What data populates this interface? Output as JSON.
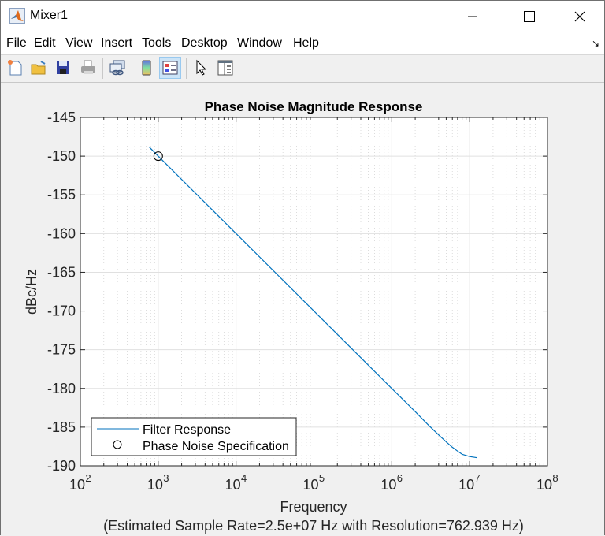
{
  "window": {
    "title": "Mixer1",
    "controls": [
      "minimize",
      "maximize",
      "close"
    ]
  },
  "menu": [
    "File",
    "Edit",
    "View",
    "Insert",
    "Tools",
    "Desktop",
    "Window",
    "Help"
  ],
  "toolbar": [
    {
      "icon": "new-figure-icon"
    },
    {
      "icon": "open-file-icon"
    },
    {
      "icon": "save-icon"
    },
    {
      "icon": "print-icon"
    },
    {
      "icon": "link-plot-icon"
    },
    {
      "icon": "colorbar-icon"
    },
    {
      "icon": "legend-icon",
      "active": true
    },
    {
      "icon": "pointer-icon"
    },
    {
      "icon": "property-inspector-icon"
    }
  ],
  "chart_data": {
    "type": "line",
    "title": "Phase Noise Magnitude Response",
    "xlabel": "Frequency",
    "ylabel": "dBc/Hz",
    "subtitle_below": "(Estimated Sample Rate=2.5e+07 Hz with Resolution=762.939 Hz)",
    "xscale": "log",
    "xlim": [
      100,
      100000000
    ],
    "ylim": [
      -190,
      -145
    ],
    "xticks": [
      100,
      1000,
      10000,
      100000,
      1000000,
      10000000,
      100000000
    ],
    "xtick_labels": [
      {
        "base": "10",
        "exp": "2"
      },
      {
        "base": "10",
        "exp": "3"
      },
      {
        "base": "10",
        "exp": "4"
      },
      {
        "base": "10",
        "exp": "5"
      },
      {
        "base": "10",
        "exp": "6"
      },
      {
        "base": "10",
        "exp": "7"
      },
      {
        "base": "10",
        "exp": "8"
      }
    ],
    "yticks": [
      -145,
      -150,
      -155,
      -160,
      -165,
      -170,
      -175,
      -180,
      -185,
      -190
    ],
    "grid": true,
    "minor_grid": true,
    "legend": {
      "location": "bottom-left",
      "entries": [
        "Filter Response",
        "Phase Noise Specification"
      ]
    },
    "series": [
      {
        "name": "Filter Response",
        "color": "#0072bd",
        "points": [
          [
            762.939,
            -148.8
          ],
          [
            1000,
            -150.0
          ],
          [
            10000,
            -160.0
          ],
          [
            100000,
            -170.0
          ],
          [
            1000000,
            -180.0
          ],
          [
            2000000,
            -183.0
          ],
          [
            3000000,
            -184.8
          ],
          [
            4000000,
            -186.0
          ],
          [
            5000000,
            -186.9
          ],
          [
            6000000,
            -187.6
          ],
          [
            7000000,
            -188.1
          ],
          [
            8000000,
            -188.5
          ],
          [
            10000000,
            -188.8
          ],
          [
            12500000,
            -188.95
          ]
        ]
      },
      {
        "name": "Phase Noise Specification",
        "marker": "circle",
        "color": "#000000",
        "points": [
          [
            1000,
            -150
          ]
        ]
      }
    ]
  }
}
